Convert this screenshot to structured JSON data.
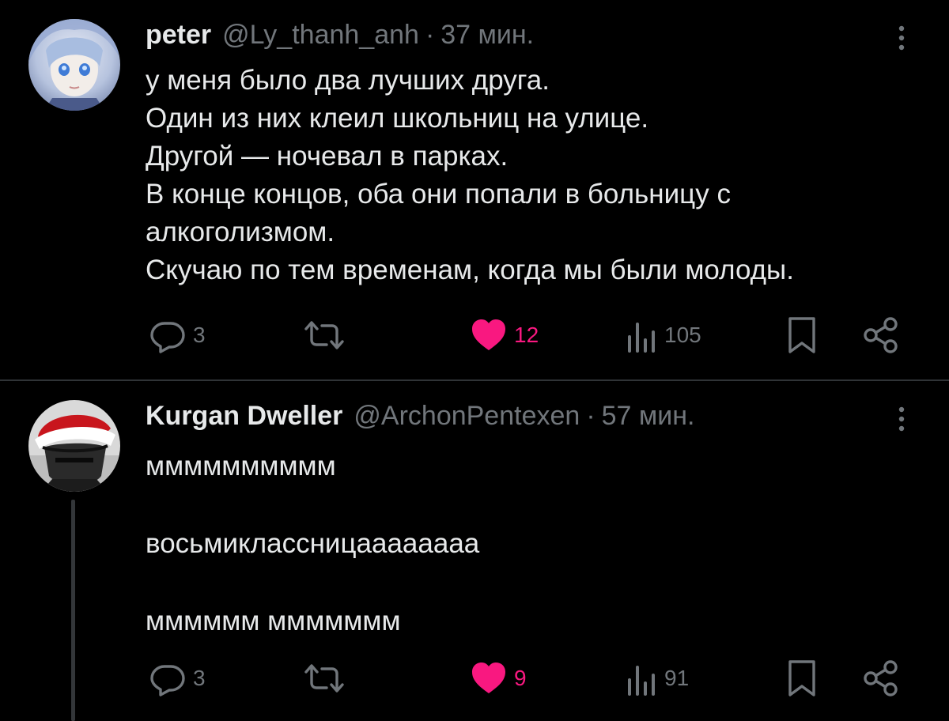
{
  "posts": [
    {
      "author_name": "peter",
      "handle": "@Ly_thanh_anh",
      "separator": "·",
      "time": "37 мин.",
      "text_lines": [
        "у меня было два лучших друга.",
        "Один из них клеил школьниц на улице.",
        "Другой — ночевал в парках.",
        "В конце концов, оба они попали в больницу с",
        "алкоголизмом.",
        "Скучаю по тем временам, когда мы были молоды."
      ],
      "replies": "3",
      "likes": "12",
      "views": "105"
    },
    {
      "author_name": "Kurgan Dweller",
      "handle": "@ArchonPentexen",
      "separator": "·",
      "time": "57 мин.",
      "text_lines": [
        "мммммммммм",
        "восьмиклассницаааааааа",
        "мммммм ммммммм"
      ],
      "replies": "3",
      "likes": "9",
      "views": "91"
    }
  ],
  "icons": {
    "reply": "reply-icon",
    "repost": "repost-icon",
    "like": "heart-icon",
    "views": "views-icon",
    "bookmark": "bookmark-icon",
    "share": "share-icon",
    "more": "more-vertical-icon"
  },
  "colors": {
    "background": "#000000",
    "text": "#e7e9ea",
    "muted": "#71767b",
    "like": "#f91880",
    "divider": "#2f3336"
  }
}
